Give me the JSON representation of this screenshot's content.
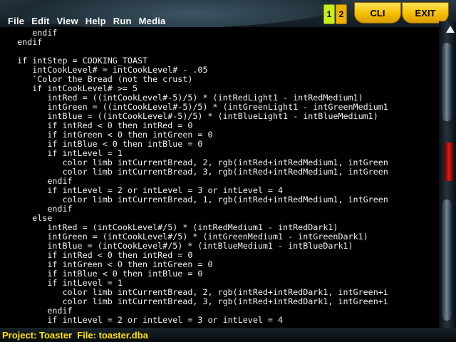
{
  "menu": [
    "File",
    "Edit",
    "View",
    "Help",
    "Run",
    "Media"
  ],
  "toolbar": {
    "btn1": "1",
    "btn2": "2",
    "cli": "CLI",
    "exit": "EXIT"
  },
  "code_text": "      endif\n   endif\n\n   if intStep = COOKING_TOAST\n      intCookLevel# = intCookLevel# - .05\n      `Color the Bread (not the crust)\n      if intCookLevel# >= 5\n         intRed = ((intCookLevel#-5)/5) * (intRedLight1 - intRedMedium1)\n         intGreen = ((intCookLevel#-5)/5) * (intGreenLight1 - intGreenMedium1\n         intBlue = ((intCookLevel#-5)/5) * (intBlueLight1 - intBlueMedium1)\n         if intRed < 0 then intRed = 0\n         if intGreen < 0 then intGreen = 0\n         if intBlue < 0 then intBlue = 0\n         if intLevel = 1\n            color limb intCurrentBread, 2, rgb(intRed+intRedMedium1, intGreen\n            color limb intCurrentBread, 3, rgb(intRed+intRedMedium1, intGreen\n         endif\n         if intLevel = 2 or intLevel = 3 or intLevel = 4\n            color limb intCurrentBread, 1, rgb(intRed+intRedMedium1, intGreen\n         endif\n      else\n         intRed = (intCookLevel#/5) * (intRedMedium1 - intRedDark1)\n         intGreen = (intCookLevel#/5) * (intGreenMedium1 - intGreenDark1)\n         intBlue = (intCookLevel#/5) * (intBlueMedium1 - intBlueDark1)\n         if intRed < 0 then intRed = 0\n         if intGreen < 0 then intGreen = 0\n         if intBlue < 0 then intBlue = 0\n         if intLevel = 1\n            color limb intCurrentBread, 2, rgb(intRed+intRedDark1, intGreen+i\n            color limb intCurrentBread, 3, rgb(intRed+intRedDark1, intGreen+i\n         endif\n         if intLevel = 2 or intLevel = 3 or intLevel = 4",
  "status": "Project: Toaster  File: toaster.dba",
  "colors": {
    "status_text": "#ffe400",
    "cli_exit": "#f5c000",
    "btn1": "#c7ee1a",
    "btn2": "#f1b000",
    "code_text": "#f0f0f0",
    "background": "#000000"
  },
  "icons": [
    "scroll-up-arrow-icon",
    "scroll-down-arrow-icon"
  ]
}
